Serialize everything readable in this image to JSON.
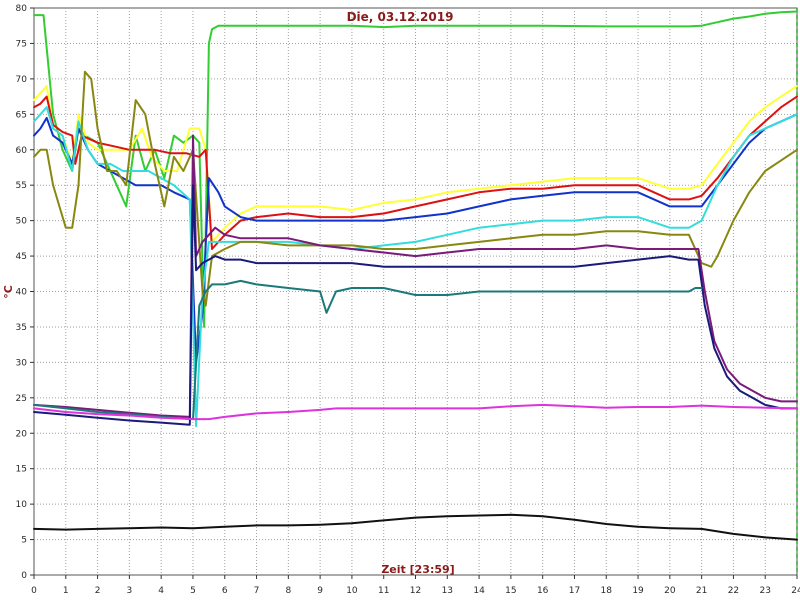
{
  "chart_data": {
    "type": "line",
    "title": "Die, 03.12.2019",
    "xlabel": "Zeit [23:59]",
    "ylabel": "°C",
    "xlim": [
      0,
      24
    ],
    "ylim": [
      0,
      80
    ],
    "x_ticks": [
      0,
      1,
      2,
      3,
      4,
      5,
      6,
      7,
      8,
      9,
      10,
      11,
      12,
      13,
      14,
      15,
      16,
      17,
      18,
      19,
      20,
      21,
      22,
      23,
      24
    ],
    "y_ticks": [
      0,
      5,
      10,
      15,
      20,
      25,
      30,
      35,
      40,
      45,
      50,
      55,
      60,
      65,
      70,
      75,
      80
    ],
    "grid": true,
    "series": [
      {
        "color": "#33cc33",
        "x": [
          0,
          0.3,
          0.6,
          0.9,
          1.2,
          1.4,
          1.6,
          2.0,
          2.3,
          2.6,
          2.9,
          3.2,
          3.5,
          3.8,
          4.1,
          4.4,
          4.7,
          5.0,
          5.2,
          5.35,
          5.5,
          5.6,
          5.8,
          6.5,
          8,
          10,
          11,
          12,
          14,
          16,
          18,
          20,
          20.6,
          21,
          21.5,
          22,
          22.5,
          23,
          23.5,
          24
        ],
        "y": [
          79,
          79,
          65,
          60,
          57,
          63,
          62,
          61,
          58,
          55,
          52,
          62,
          57,
          60,
          56,
          62,
          61,
          62,
          61,
          35,
          75,
          77,
          77.5,
          77.5,
          77.5,
          77.5,
          77.3,
          77.5,
          77.5,
          77.5,
          77.4,
          77.4,
          77.4,
          77.5,
          78,
          78.5,
          78.8,
          79.2,
          79.4,
          79.5
        ]
      },
      {
        "color": "#ffff33",
        "x": [
          0,
          0.2,
          0.4,
          0.6,
          0.9,
          1.2,
          1.4,
          1.7,
          2.0,
          2.4,
          3.0,
          3.4,
          3.7,
          4.1,
          4.5,
          4.9,
          5.2,
          5.4,
          5.6,
          6,
          6.5,
          7,
          8,
          9,
          10,
          11,
          12,
          13,
          14,
          15,
          16,
          17,
          18,
          19,
          20,
          20.6,
          21,
          21.5,
          22,
          22.5,
          23,
          23.5,
          24
        ],
        "y": [
          67,
          68,
          69,
          63,
          62,
          58,
          65,
          61,
          60,
          60,
          60,
          63,
          59,
          57,
          57,
          63,
          63,
          60,
          47,
          49,
          51,
          52,
          52,
          52,
          51.5,
          52.5,
          53,
          54,
          54.5,
          55,
          55.5,
          56,
          56,
          56,
          54.5,
          54.5,
          55,
          58,
          61,
          64,
          66,
          67.5,
          69
        ]
      },
      {
        "color": "#dd1111",
        "x": [
          0,
          0.2,
          0.4,
          0.6,
          0.9,
          1.2,
          1.3,
          1.5,
          2.0,
          2.5,
          3.0,
          3.5,
          3.8,
          4.3,
          4.8,
          5.2,
          5.4,
          5.6,
          6,
          6.5,
          7,
          8,
          9,
          10,
          11,
          12,
          13,
          14,
          15,
          16,
          17,
          18,
          19,
          20,
          20.6,
          21,
          21.5,
          22,
          22.5,
          23,
          23.5,
          24
        ],
        "y": [
          66,
          66.5,
          67.5,
          63.5,
          62.5,
          62,
          58,
          62,
          61,
          60.5,
          60,
          60,
          60,
          59.5,
          59.5,
          59,
          60,
          46,
          48,
          50,
          50.5,
          51,
          50.5,
          50.5,
          51,
          52,
          53,
          54,
          54.5,
          54.5,
          55,
          55,
          55,
          53,
          53,
          53.5,
          56,
          59,
          62,
          64,
          66,
          67.5
        ]
      },
      {
        "color": "#1133cc",
        "x": [
          0,
          0.2,
          0.4,
          0.6,
          0.9,
          1.2,
          1.4,
          1.7,
          2.0,
          2.4,
          2.8,
          3.2,
          3.6,
          4.0,
          4.4,
          4.9,
          5.1,
          5.3,
          5.5,
          5.8,
          6,
          6.5,
          7,
          8,
          9,
          10,
          11,
          12,
          13,
          14,
          15,
          16,
          17,
          18,
          19,
          20,
          20.6,
          21,
          21.5,
          22,
          22.5,
          23,
          23.5,
          24
        ],
        "y": [
          62,
          63,
          64.5,
          62,
          61,
          58,
          63,
          60,
          58,
          57,
          56,
          55,
          55,
          55,
          54,
          53,
          30,
          37,
          56,
          54,
          52,
          50.5,
          50,
          50,
          50,
          50,
          50,
          50.5,
          51,
          52,
          53,
          53.5,
          54,
          54,
          54,
          52,
          52,
          52,
          55,
          58,
          61,
          63,
          64,
          65
        ]
      },
      {
        "color": "#33dddd",
        "x": [
          0,
          0.2,
          0.4,
          0.6,
          0.9,
          1.2,
          1.4,
          1.7,
          2.0,
          2.4,
          2.8,
          3.2,
          3.6,
          4.0,
          4.4,
          4.9,
          5.1,
          5.3,
          5.5,
          5.8,
          6,
          6.5,
          7,
          8,
          9,
          10,
          11,
          12,
          13,
          14,
          15,
          16,
          17,
          18,
          19,
          20,
          20.6,
          21,
          21.5,
          22,
          22.5,
          23,
          23.5,
          24
        ],
        "y": [
          64,
          65,
          66,
          63,
          62,
          57,
          64,
          60,
          58,
          58,
          57,
          57,
          57,
          56,
          55,
          53,
          21,
          40,
          47,
          47,
          47,
          47,
          47,
          47,
          46.5,
          46,
          46.5,
          47,
          48,
          49,
          49.5,
          50,
          50,
          50.5,
          50.5,
          49,
          49,
          50,
          55,
          59,
          62,
          63,
          64,
          65
        ]
      },
      {
        "color": "#888811",
        "x": [
          0,
          0.2,
          0.4,
          0.6,
          0.8,
          1.0,
          1.2,
          1.4,
          1.6,
          1.8,
          2.0,
          2.3,
          2.6,
          2.9,
          3.2,
          3.5,
          3.8,
          4.1,
          4.4,
          4.7,
          5.0,
          5.3,
          5.4,
          5.6,
          6,
          6.5,
          7,
          8,
          9,
          10,
          11,
          12,
          13,
          14,
          15,
          16,
          17,
          18,
          19,
          20,
          20.6,
          21,
          21.3,
          21.5,
          22,
          22.5,
          23,
          23.5,
          24
        ],
        "y": [
          59,
          60,
          60,
          55,
          52,
          49,
          49,
          55,
          71,
          70,
          63,
          57,
          57,
          55,
          67,
          65,
          58,
          52,
          59,
          57,
          60,
          40,
          38,
          45,
          46,
          47,
          47,
          46.5,
          46.5,
          46.5,
          46,
          46,
          46.5,
          47,
          47.5,
          48,
          48,
          48.5,
          48.5,
          48,
          48,
          44,
          43.5,
          45,
          50,
          54,
          57,
          58.5,
          60
        ]
      },
      {
        "color": "#7a1a7a",
        "x": [
          0,
          1,
          2,
          3,
          4,
          4.9,
          5.0,
          5.1,
          5.3,
          5.5,
          5.7,
          6,
          6.5,
          7,
          8,
          9,
          10,
          11,
          12,
          13,
          14,
          15,
          16,
          17,
          18,
          19,
          20,
          20.6,
          20.9,
          21.1,
          21.4,
          21.8,
          22.2,
          22.6,
          23,
          23.5,
          24
        ],
        "y": [
          24,
          23.7,
          23.3,
          22.9,
          22.5,
          22.3,
          62,
          45,
          47,
          48,
          49,
          48,
          47.5,
          47.5,
          47.5,
          46.5,
          46,
          45.5,
          45,
          45.5,
          46,
          46,
          46,
          46,
          46.5,
          46,
          46,
          46,
          46,
          40,
          33,
          29,
          27,
          26,
          25,
          24.5,
          24.5
        ]
      },
      {
        "color": "#1a1a7a",
        "x": [
          0,
          1,
          2,
          3,
          4,
          4.9,
          5.0,
          5.1,
          5.3,
          5.5,
          5.7,
          6,
          6.5,
          7,
          8,
          9,
          10,
          11,
          12,
          13,
          14,
          15,
          16,
          17,
          18,
          19,
          20,
          20.6,
          20.9,
          21.1,
          21.4,
          21.8,
          22.2,
          22.6,
          23,
          23.5,
          24
        ],
        "y": [
          23,
          22.6,
          22.2,
          21.8,
          21.5,
          21.2,
          55,
          43,
          44,
          44.5,
          45,
          44.5,
          44.5,
          44,
          44,
          44,
          44,
          43.5,
          43.5,
          43.5,
          43.5,
          43.5,
          43.5,
          43.5,
          44,
          44.5,
          45,
          44.5,
          44.5,
          38,
          32,
          28,
          26,
          25,
          24,
          23.5,
          23.5
        ]
      },
      {
        "color": "#1a7a7a",
        "x": [
          0,
          1,
          2,
          3,
          4,
          5.0,
          5.2,
          5.4,
          5.6,
          6,
          6.5,
          7,
          8,
          9,
          9.2,
          9.5,
          10,
          11,
          12,
          13,
          14,
          15,
          16,
          17,
          18,
          19,
          20,
          20.6,
          20.8,
          21.0
        ],
        "y": [
          24,
          23.5,
          23,
          22.7,
          22.3,
          22,
          38,
          40,
          41,
          41,
          41.5,
          41,
          40.5,
          40,
          37,
          40,
          40.5,
          40.5,
          39.5,
          39.5,
          40,
          40,
          40,
          40,
          40,
          40,
          40,
          40,
          40.5,
          40.5
        ]
      },
      {
        "color": "#dd33dd",
        "x": [
          0,
          1,
          2,
          3,
          4,
          5,
          5.5,
          6,
          7,
          8,
          9,
          9.5,
          10,
          12,
          14,
          15,
          16,
          17,
          18,
          19,
          20,
          21,
          22,
          23,
          24
        ],
        "y": [
          23.5,
          23,
          22.7,
          22.5,
          22.2,
          22,
          22,
          22.3,
          22.8,
          23,
          23.3,
          23.5,
          23.5,
          23.5,
          23.5,
          23.8,
          24,
          23.8,
          23.6,
          23.7,
          23.7,
          23.9,
          23.7,
          23.6,
          23.5
        ]
      },
      {
        "color": "#111111",
        "x": [
          0,
          1,
          2,
          3,
          4,
          5,
          6,
          7,
          8,
          9,
          10,
          11,
          12,
          13,
          14,
          15,
          16,
          17,
          18,
          19,
          20,
          21,
          22,
          23,
          24
        ],
        "y": [
          6.5,
          6.4,
          6.5,
          6.6,
          6.7,
          6.6,
          6.8,
          7.0,
          7.0,
          7.1,
          7.3,
          7.7,
          8.1,
          8.3,
          8.4,
          8.5,
          8.3,
          7.8,
          7.2,
          6.8,
          6.6,
          6.5,
          5.8,
          5.3,
          5.0
        ]
      }
    ]
  }
}
